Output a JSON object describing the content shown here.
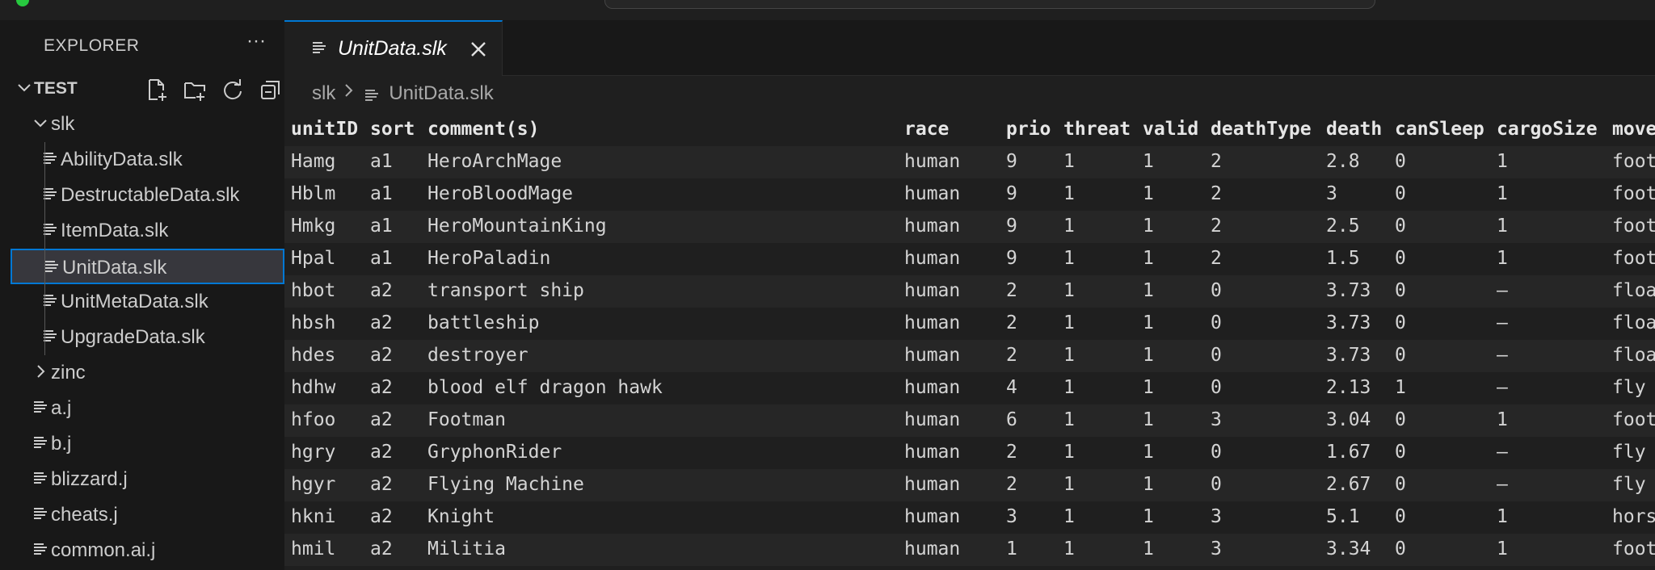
{
  "explorer": {
    "title": "EXPLORER",
    "more": "···",
    "root": {
      "label": "TEST"
    },
    "tree": [
      {
        "label": "slk",
        "type": "folder",
        "open": true,
        "indent": 1
      },
      {
        "label": "AbilityData.slk",
        "type": "file",
        "indent": 2
      },
      {
        "label": "DestructableData.slk",
        "type": "file",
        "indent": 2
      },
      {
        "label": "ItemData.slk",
        "type": "file",
        "indent": 2
      },
      {
        "label": "UnitData.slk",
        "type": "file",
        "indent": 2,
        "selected": true
      },
      {
        "label": "UnitMetaData.slk",
        "type": "file",
        "indent": 2
      },
      {
        "label": "UpgradeData.slk",
        "type": "file",
        "indent": 2
      },
      {
        "label": "zinc",
        "type": "folder",
        "open": false,
        "indent": 1
      },
      {
        "label": "a.j",
        "type": "file",
        "indent": 1
      },
      {
        "label": "b.j",
        "type": "file",
        "indent": 1
      },
      {
        "label": "blizzard.j",
        "type": "file",
        "indent": 1
      },
      {
        "label": "cheats.j",
        "type": "file",
        "indent": 1
      },
      {
        "label": "common.ai.j",
        "type": "file",
        "indent": 1
      }
    ]
  },
  "editor": {
    "tab_label": "UnitData.slk",
    "breadcrumb": {
      "folder": "slk",
      "file": "UnitData.slk"
    }
  },
  "table": {
    "columns": [
      "unitID",
      "sort",
      "comment(s)",
      "race",
      "prio",
      "threat",
      "valid",
      "deathType",
      "death",
      "canSleep",
      "cargoSize",
      "move"
    ],
    "rows": [
      [
        "Hamg",
        "a1",
        "HeroArchMage",
        "human",
        "9",
        "1",
        "1",
        "2",
        "2.8",
        "0",
        "1",
        "foot"
      ],
      [
        "Hblm",
        "a1",
        "HeroBloodMage",
        "human",
        "9",
        "1",
        "1",
        "2",
        "3",
        "0",
        "1",
        "foot"
      ],
      [
        "Hmkg",
        "a1",
        "HeroMountainKing",
        "human",
        "9",
        "1",
        "1",
        "2",
        "2.5",
        "0",
        "1",
        "foot"
      ],
      [
        "Hpal",
        "a1",
        "HeroPaladin",
        "human",
        "9",
        "1",
        "1",
        "2",
        "1.5",
        "0",
        "1",
        "foot"
      ],
      [
        "hbot",
        "a2",
        "transport ship",
        "human",
        "2",
        "1",
        "1",
        "0",
        "3.73",
        "0",
        "–",
        "floa"
      ],
      [
        "hbsh",
        "a2",
        "battleship",
        "human",
        "2",
        "1",
        "1",
        "0",
        "3.73",
        "0",
        "–",
        "floa"
      ],
      [
        "hdes",
        "a2",
        "destroyer",
        "human",
        "2",
        "1",
        "1",
        "0",
        "3.73",
        "0",
        "–",
        "floa"
      ],
      [
        "hdhw",
        "a2",
        "blood elf dragon hawk",
        "human",
        "4",
        "1",
        "1",
        "0",
        "2.13",
        "1",
        "–",
        "fly"
      ],
      [
        "hfoo",
        "a2",
        "Footman",
        "human",
        "6",
        "1",
        "1",
        "3",
        "3.04",
        "0",
        "1",
        "foot"
      ],
      [
        "hgry",
        "a2",
        "GryphonRider",
        "human",
        "2",
        "1",
        "1",
        "0",
        "1.67",
        "0",
        "–",
        "fly"
      ],
      [
        "hgyr",
        "a2",
        "Flying Machine",
        "human",
        "2",
        "1",
        "1",
        "0",
        "2.67",
        "0",
        "–",
        "fly"
      ],
      [
        "hkni",
        "a2",
        "Knight",
        "human",
        "3",
        "1",
        "1",
        "3",
        "5.1",
        "0",
        "1",
        "hors"
      ],
      [
        "hmil",
        "a2",
        "Militia",
        "human",
        "1",
        "1",
        "1",
        "3",
        "3.34",
        "0",
        "1",
        "foot"
      ]
    ]
  },
  "colors": {
    "accent": "#0078d4",
    "selected_bg": "#37373d",
    "editor_bg": "#1f1f1f",
    "sidebar_bg": "#181818"
  },
  "icons": [
    "new-file-icon",
    "new-folder-icon",
    "refresh-icon",
    "collapse-all-icon",
    "file-lines-icon",
    "close-icon",
    "chevron-down-icon",
    "chevron-right-icon"
  ]
}
